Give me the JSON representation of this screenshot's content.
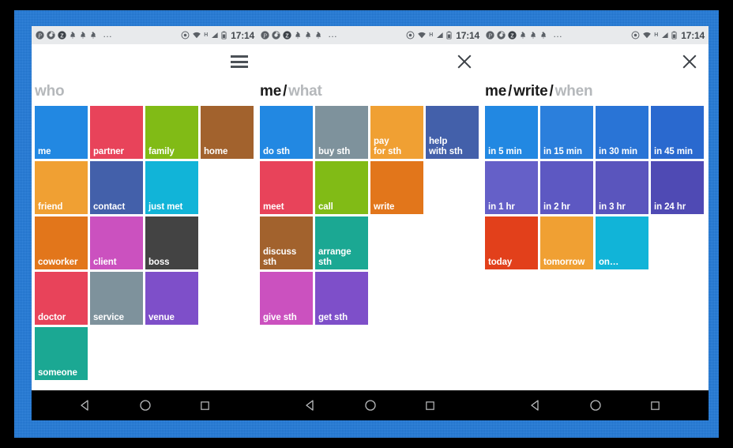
{
  "background": {
    "color": "#2079d8",
    "frame_color": "#000000"
  },
  "statusbar": {
    "icons_left": [
      "pinterest-icon",
      "chrome-icon",
      "z-badge-icon",
      "bell-icon",
      "bell-icon",
      "bell-icon"
    ],
    "overflow": "…",
    "icons_right": [
      "target-icon",
      "wifi-icon"
    ],
    "network_type": "H",
    "signal": "signal-icon",
    "battery": "battery-icon",
    "time": "17:14"
  },
  "navbar": {
    "back": "back-triangle-icon",
    "home": "home-circle-icon",
    "recents": "recents-square-icon"
  },
  "panels": [
    {
      "name": "who-screen",
      "menu_icon": "hamburger-icon",
      "crumbs": [
        {
          "text": "who",
          "muted": true
        }
      ],
      "tiles": [
        {
          "label": "me",
          "color": "#2288e2"
        },
        {
          "label": "partner",
          "color": "#e8435a"
        },
        {
          "label": "family",
          "color": "#81bb16"
        },
        {
          "label": "home",
          "color": "#a2622d"
        },
        {
          "label": "friend",
          "color": "#f0a033"
        },
        {
          "label": "contact",
          "color": "#4360aa"
        },
        {
          "label": "just met",
          "color": "#11b4d8"
        },
        {
          "label": "coworker",
          "color": "#e2761b"
        },
        {
          "label": "client",
          "color": "#cb51bf"
        },
        {
          "label": "boss",
          "color": "#434343"
        },
        {
          "label": "doctor",
          "color": "#e8435a"
        },
        {
          "label": "service",
          "color": "#7e929c"
        },
        {
          "label": "venue",
          "color": "#7e4fc9"
        },
        {
          "label": "someone",
          "color": "#1ba893"
        }
      ]
    },
    {
      "name": "what-screen",
      "menu_icon": "close-icon",
      "crumbs": [
        {
          "text": "me",
          "muted": false
        },
        {
          "text": "what",
          "muted": true
        }
      ],
      "tiles": [
        {
          "label": "do sth",
          "color": "#2288e2"
        },
        {
          "label": "buy sth",
          "color": "#7e929c"
        },
        {
          "label": "pay\nfor sth",
          "color": "#f0a033"
        },
        {
          "label": "help\nwith sth",
          "color": "#4360aa"
        },
        {
          "label": "meet",
          "color": "#e8435a"
        },
        {
          "label": "call",
          "color": "#81bb16"
        },
        {
          "label": "write",
          "color": "#e2761b"
        },
        {
          "label": "discuss\nsth",
          "color": "#a2622d"
        },
        {
          "label": "arrange\nsth",
          "color": "#1ba893"
        },
        {
          "label": "give sth",
          "color": "#cb51bf"
        },
        {
          "label": "get sth",
          "color": "#7e4fc9"
        }
      ]
    },
    {
      "name": "when-screen",
      "menu_icon": "close-icon",
      "crumbs": [
        {
          "text": "me",
          "muted": false
        },
        {
          "text": "write",
          "muted": false
        },
        {
          "text": "when",
          "muted": true
        }
      ],
      "tiles": [
        {
          "label": "in 5 min",
          "color": "#2288e2"
        },
        {
          "label": "in 15 min",
          "color": "#2b7fdc"
        },
        {
          "label": "in 30 min",
          "color": "#2974d6"
        },
        {
          "label": "in 45 min",
          "color": "#2a69cf"
        },
        {
          "label": "in 1 hr",
          "color": "#6560c8"
        },
        {
          "label": "in 2 hr",
          "color": "#5d58c2"
        },
        {
          "label": "in 3 hr",
          "color": "#5a55bd"
        },
        {
          "label": "in 24 hr",
          "color": "#4f4ab4"
        },
        {
          "label": "today",
          "color": "#e2401b"
        },
        {
          "label": "tomorrow",
          "color": "#f0a033"
        },
        {
          "label": "on…",
          "color": "#11b4d8"
        }
      ]
    }
  ]
}
